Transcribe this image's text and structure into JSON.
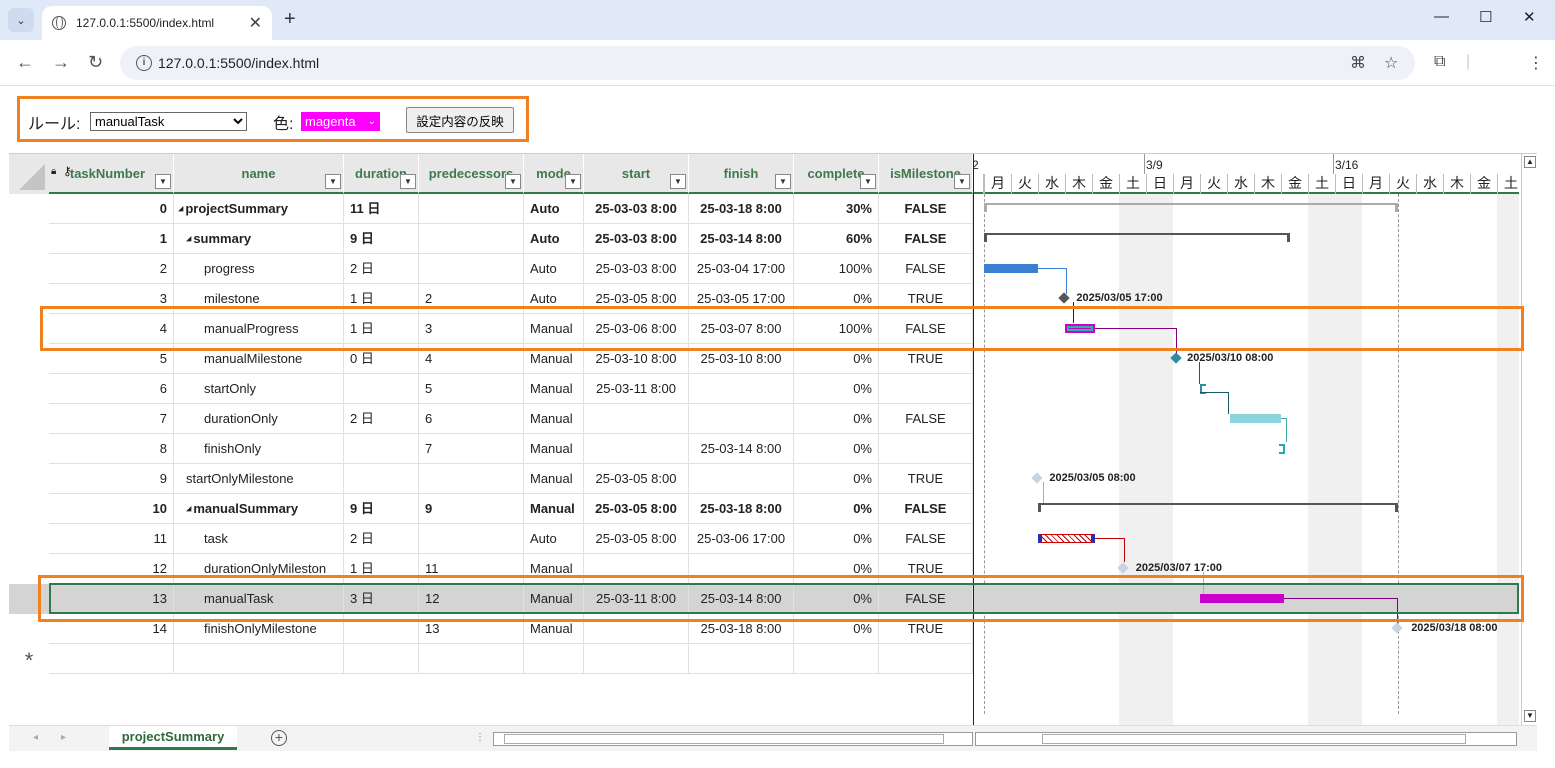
{
  "browser": {
    "tab_title": "127.0.0.1:5500/index.html",
    "url": "127.0.0.1:5500/index.html"
  },
  "controls": {
    "rule_label": "ルール:",
    "rule_value": "manualTask",
    "color_label": "色:",
    "color_value": "magenta",
    "apply_button": "設定内容の反映"
  },
  "columns": [
    "taskNumber",
    "name",
    "duration",
    "predecessors",
    "mode",
    "start",
    "finish",
    "complete",
    "isMilestone"
  ],
  "rows": [
    {
      "taskNumber": "0",
      "name": "projectSummary",
      "duration": "11 日",
      "predecessors": "",
      "mode": "Auto",
      "start": "25-03-03 8:00",
      "finish": "25-03-18 8:00",
      "complete": "30%",
      "isMilestone": "FALSE",
      "bold": true,
      "indent": 0,
      "collapse": true
    },
    {
      "taskNumber": "1",
      "name": "summary",
      "duration": "9 日",
      "predecessors": "",
      "mode": "Auto",
      "start": "25-03-03 8:00",
      "finish": "25-03-14 8:00",
      "complete": "60%",
      "isMilestone": "FALSE",
      "bold": true,
      "indent": 1,
      "collapse": true
    },
    {
      "taskNumber": "2",
      "name": "progress",
      "duration": "2 日",
      "predecessors": "",
      "mode": "Auto",
      "start": "25-03-03 8:00",
      "finish": "25-03-04 17:00",
      "complete": "100%",
      "isMilestone": "FALSE",
      "indent": 2
    },
    {
      "taskNumber": "3",
      "name": "milestone",
      "duration": "1 日",
      "predecessors": "2",
      "mode": "Auto",
      "start": "25-03-05 8:00",
      "finish": "25-03-05 17:00",
      "complete": "0%",
      "isMilestone": "TRUE",
      "indent": 2
    },
    {
      "taskNumber": "4",
      "name": "manualProgress",
      "duration": "1 日",
      "predecessors": "3",
      "mode": "Manual",
      "start": "25-03-06 8:00",
      "finish": "25-03-07 8:00",
      "complete": "100%",
      "isMilestone": "FALSE",
      "indent": 2
    },
    {
      "taskNumber": "5",
      "name": "manualMilestone",
      "duration": "0 日",
      "predecessors": "4",
      "mode": "Manual",
      "start": "25-03-10 8:00",
      "finish": "25-03-10 8:00",
      "complete": "0%",
      "isMilestone": "TRUE",
      "indent": 2
    },
    {
      "taskNumber": "6",
      "name": "startOnly",
      "duration": "",
      "predecessors": "5",
      "mode": "Manual",
      "start": "25-03-11 8:00",
      "finish": "",
      "complete": "0%",
      "isMilestone": "",
      "indent": 2
    },
    {
      "taskNumber": "7",
      "name": "durationOnly",
      "duration": "2 日",
      "predecessors": "6",
      "mode": "Manual",
      "start": "",
      "finish": "",
      "complete": "0%",
      "isMilestone": "FALSE",
      "indent": 2
    },
    {
      "taskNumber": "8",
      "name": "finishOnly",
      "duration": "",
      "predecessors": "7",
      "mode": "Manual",
      "start": "",
      "finish": "25-03-14 8:00",
      "complete": "0%",
      "isMilestone": "",
      "indent": 2
    },
    {
      "taskNumber": "9",
      "name": "startOnlyMilestone",
      "duration": "",
      "predecessors": "",
      "mode": "Manual",
      "start": "25-03-05 8:00",
      "finish": "",
      "complete": "0%",
      "isMilestone": "TRUE",
      "indent": 1
    },
    {
      "taskNumber": "10",
      "name": "manualSummary",
      "duration": "9 日",
      "predecessors": "9",
      "mode": "Manual",
      "start": "25-03-05 8:00",
      "finish": "25-03-18 8:00",
      "complete": "0%",
      "isMilestone": "FALSE",
      "bold": true,
      "indent": 1,
      "collapse": true
    },
    {
      "taskNumber": "11",
      "name": "task",
      "duration": "2 日",
      "predecessors": "",
      "mode": "Auto",
      "start": "25-03-05 8:00",
      "finish": "25-03-06 17:00",
      "complete": "0%",
      "isMilestone": "FALSE",
      "indent": 2
    },
    {
      "taskNumber": "12",
      "name": "durationOnlyMileston",
      "duration": "1 日",
      "predecessors": "11",
      "mode": "Manual",
      "start": "",
      "finish": "",
      "complete": "0%",
      "isMilestone": "TRUE",
      "indent": 2
    },
    {
      "taskNumber": "13",
      "name": "manualTask",
      "duration": "3 日",
      "predecessors": "12",
      "mode": "Manual",
      "start": "25-03-11 8:00",
      "finish": "25-03-14 8:00",
      "complete": "0%",
      "isMilestone": "FALSE",
      "indent": 2,
      "selected": true
    },
    {
      "taskNumber": "14",
      "name": "finishOnlyMilestone",
      "duration": "",
      "predecessors": "13",
      "mode": "Manual",
      "start": "",
      "finish": "25-03-18 8:00",
      "complete": "0%",
      "isMilestone": "TRUE",
      "indent": 2
    }
  ],
  "new_row_marker": "*",
  "gantt": {
    "week_labels": [
      "2",
      "3/9",
      "3/16"
    ],
    "weekdays": [
      "月",
      "火",
      "水",
      "木",
      "金",
      "土",
      "日",
      "月",
      "火",
      "水",
      "木",
      "金",
      "土",
      "日",
      "月",
      "火",
      "水",
      "木",
      "金",
      "土"
    ],
    "labels": [
      "2025/03/05 17:00",
      "2025/03/10 08:00",
      "2025/03/05 08:00",
      "2025/03/07 17:00",
      "2025/03/18 08:00"
    ],
    "colors": {
      "progress": "#3a7fd0",
      "manual": "#cc00cc",
      "milestone": "#555555",
      "manual_milestone": "#2a8ea0",
      "light_milestone": "#c8d4e4",
      "teal": "#7fd0d8",
      "summary": "#555555",
      "dependency_red": "#c00000"
    }
  },
  "sheet_tab": "projectSummary"
}
